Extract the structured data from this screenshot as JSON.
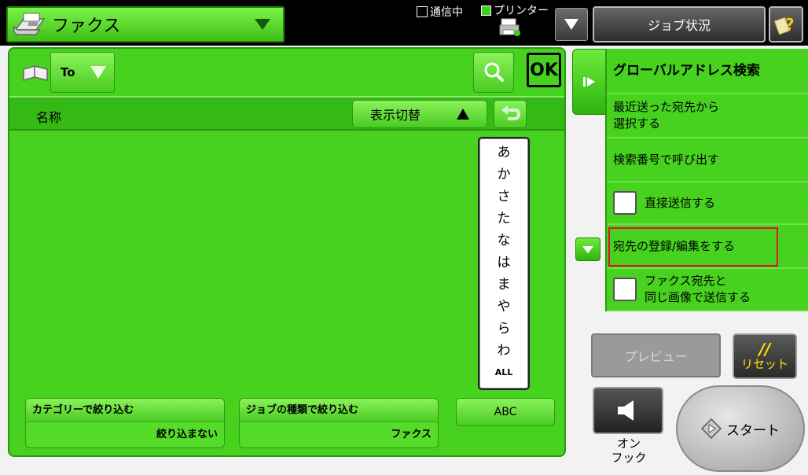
{
  "topbar": {
    "mode_label": "ファクス",
    "comm_status": "通信中",
    "printer_status": "プリンター",
    "job_status_label": "ジョブ状況"
  },
  "address": {
    "to_label": "To",
    "ok_label": "OK",
    "column_name": "名称",
    "display_toggle_label": "表示切替",
    "kana_index": [
      "あ",
      "か",
      "さ",
      "た",
      "な",
      "は",
      "ま",
      "や",
      "ら",
      "わ",
      "ALL"
    ],
    "filter_category": {
      "title": "カテゴリーで絞り込む",
      "value": "絞り込まない"
    },
    "filter_job": {
      "title": "ジョブの種類で絞り込む",
      "value": "ファクス"
    },
    "abc_label": "ABC"
  },
  "actions": {
    "global_search": "グローバルアドレス検索",
    "recent_line1": "最近送った宛先から",
    "recent_line2": "選択する",
    "recall_by_number": "検索番号で呼び出す",
    "direct_send": "直接送信する",
    "register_edit": "宛先の登録/編集をする",
    "same_image_line1": "ファクス宛先と",
    "same_image_line2": "同じ画像で送信する"
  },
  "controls": {
    "preview_label": "プレビュー",
    "reset_symbol": "//",
    "reset_label": "リセット",
    "onhook_line1": "オン",
    "onhook_line2": "フック",
    "start_label": "スタート"
  },
  "colors": {
    "accent_green": "#46d21f",
    "highlight_red": "#e0141e",
    "reset_yellow": "#ffe000"
  }
}
